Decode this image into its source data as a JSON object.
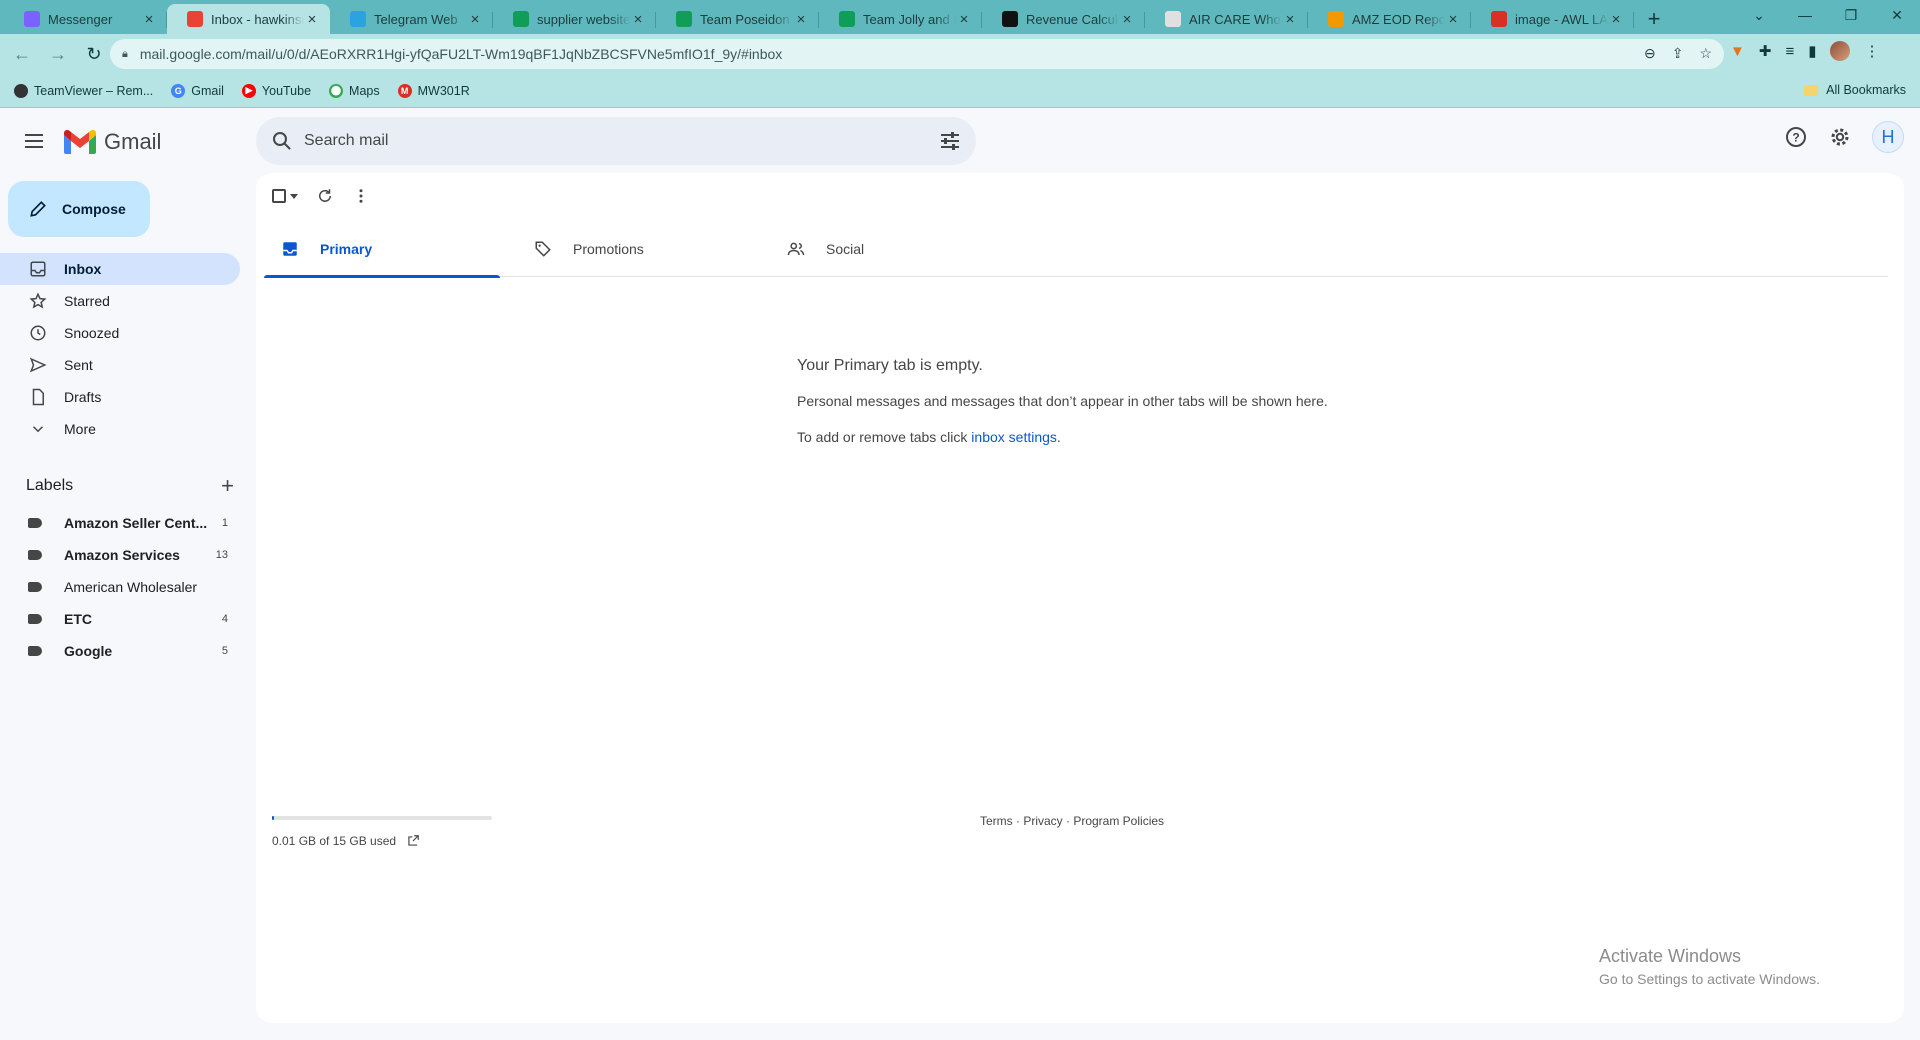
{
  "browser": {
    "tabs": [
      {
        "title": "Messenger",
        "icon": "messenger-icon",
        "color": "#7b61ff"
      },
      {
        "title": "Inbox - hawkinsne",
        "icon": "gmail-icon",
        "color": "#ea4335",
        "active": true
      },
      {
        "title": "Telegram Web",
        "icon": "telegram-icon",
        "color": "#2aa3e0"
      },
      {
        "title": "supplier website",
        "icon": "sheets-icon",
        "color": "#0f9d58"
      },
      {
        "title": "Team Poseidon PF",
        "icon": "sheets-icon",
        "color": "#0f9d58"
      },
      {
        "title": "Team Jolly and M",
        "icon": "sheets-icon",
        "color": "#0f9d58"
      },
      {
        "title": "Revenue Calculato",
        "icon": "amazon-icon",
        "color": "#111111"
      },
      {
        "title": "AIR CARE Wholes",
        "icon": "page-icon",
        "color": "#e0e0e0"
      },
      {
        "title": "AMZ EOD Report",
        "icon": "report-icon",
        "color": "#f29900"
      },
      {
        "title": "image - AWL LABE",
        "icon": "vivaldi-icon",
        "color": "#d93025"
      }
    ],
    "url": "mail.google.com/mail/u/0/d/AEoRXRR1Hgi-yfQaFU2LT-Wm19qBF1JqNbZBCSFVNe5mfIO1f_9y/#inbox",
    "bookmarks": [
      {
        "label": "TeamViewer – Rem...",
        "color": "#333333",
        "letter": ""
      },
      {
        "label": "Gmail",
        "color": "#4285f4",
        "letter": "G"
      },
      {
        "label": "YouTube",
        "color": "#ff0000",
        "letter": "▶"
      },
      {
        "label": "Maps",
        "color": "#34a853",
        "letter": "⬤"
      },
      {
        "label": "MW301R",
        "color": "#d93025",
        "letter": "M"
      }
    ],
    "all_bookmarks": "All Bookmarks"
  },
  "gmail": {
    "logo_text": "Gmail",
    "search_placeholder": "Search mail",
    "account_initial": "H",
    "compose_label": "Compose",
    "nav": [
      {
        "label": "Inbox",
        "icon": "inbox-icon",
        "active": true
      },
      {
        "label": "Starred",
        "icon": "star-icon"
      },
      {
        "label": "Snoozed",
        "icon": "clock-icon"
      },
      {
        "label": "Sent",
        "icon": "send-icon"
      },
      {
        "label": "Drafts",
        "icon": "draft-icon"
      },
      {
        "label": "More",
        "icon": "chevron-down-icon"
      }
    ],
    "labels_title": "Labels",
    "labels": [
      {
        "name": "Amazon Seller Cent...",
        "count": "1",
        "bold": true
      },
      {
        "name": "Amazon Services",
        "count": "13",
        "bold": true
      },
      {
        "name": "American Wholesaler",
        "count": "",
        "bold": false
      },
      {
        "name": "ETC",
        "count": "4",
        "bold": true
      },
      {
        "name": "Google",
        "count": "5",
        "bold": true
      }
    ],
    "tabs": [
      {
        "label": "Primary",
        "icon": "inbox-tab-icon",
        "active": true
      },
      {
        "label": "Promotions",
        "icon": "tag-icon"
      },
      {
        "label": "Social",
        "icon": "people-icon"
      }
    ],
    "empty": {
      "heading": "Your Primary tab is empty.",
      "line1": "Personal messages and messages that don’t appear in other tabs will be shown here.",
      "line2_prefix": "To add or remove tabs click ",
      "line2_link": "inbox settings",
      "line2_suffix": "."
    },
    "storage": {
      "text": "0.01 GB of 15 GB used",
      "fraction": 0.001
    },
    "footer": "Terms · Privacy · Program Policies"
  },
  "activate_windows": {
    "title": "Activate Windows",
    "subtitle": "Go to Settings to activate Windows."
  },
  "colors": {
    "accent": "#0b57d0",
    "compose_bg": "#c2e7ff",
    "active_nav": "#d3e3fd",
    "chrome_teal": "#5fb8bd"
  }
}
